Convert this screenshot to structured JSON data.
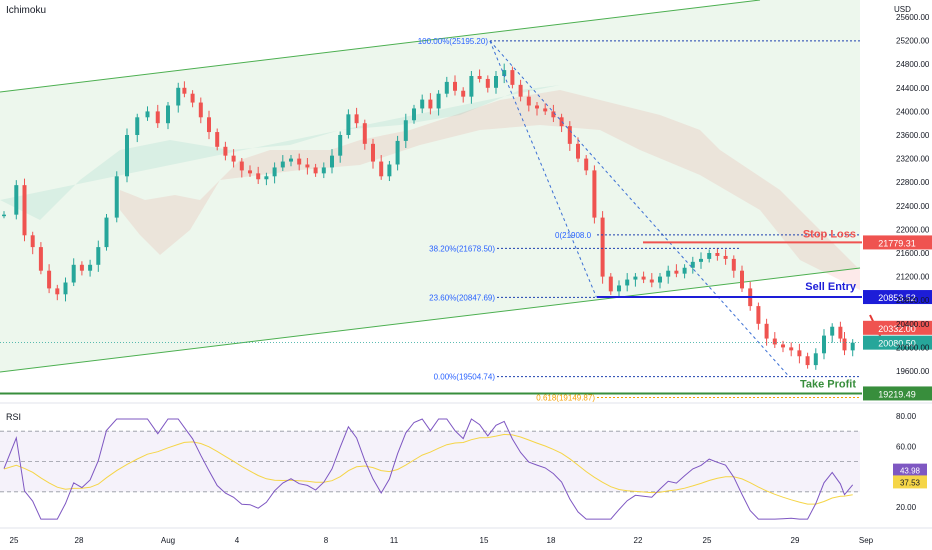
{
  "indicator_label": "Ichimoku",
  "currency": "USD",
  "rsi_label": "RSI",
  "colors": {
    "up": "#26a69a",
    "down": "#ef5350",
    "channel": "#4caf50",
    "fib_line": "#1e40af",
    "stop_loss": "#ef5350",
    "sell_entry": "#1d1dd8",
    "take_profit": "#388e3c",
    "fib_ext": "#f59f00",
    "rsi_line": "#7e57c2",
    "rsi_ma": "#f5d547"
  },
  "price_axis": {
    "min": 19000,
    "max": 25800,
    "ticks": [
      "25600.00",
      "25200.00",
      "24800.00",
      "24400.00",
      "24000.00",
      "23600.00",
      "23200.00",
      "22800.00",
      "22400.00",
      "22000.00",
      "21600.00",
      "21200.00",
      "20800.00",
      "20400.00",
      "20000.00",
      "19600.00"
    ]
  },
  "rsi_axis": {
    "ticks": [
      "80.00",
      "60.00",
      "40.00",
      "20.00"
    ],
    "upper_band": 70,
    "lower_band": 30,
    "mid": 50,
    "rsi_value": "43.98",
    "ma_value": "37.53"
  },
  "time_axis": [
    "25",
    "28",
    "Aug",
    "4",
    "8",
    "11",
    "15",
    "18",
    "22",
    "25",
    "29",
    "Sep"
  ],
  "fib_levels": [
    {
      "label": "100.00%(25195.20)",
      "value": 25195.2
    },
    {
      "label": "38.20%(21678.50)",
      "value": 21678.5
    },
    {
      "label": "23.60%(20847.69)",
      "value": 20847.69
    },
    {
      "label": "0.00%(19504.74)",
      "value": 19504.74
    }
  ],
  "fib_ext": {
    "label": "0.618(19149.87)",
    "value": 19149.87
  },
  "fib_small": {
    "label": "0(21908.0",
    "value": 21908
  },
  "levels": {
    "stop_loss": {
      "label": "Stop Loss",
      "price": "21779.31",
      "value": 21779.31
    },
    "sell_entry": {
      "label": "Sell Entry",
      "price": "20853.52",
      "value": 20853.52
    },
    "take_profit": {
      "label": "Take Profit",
      "price": "19219.49",
      "value": 19219.49
    }
  },
  "price_badges": [
    {
      "price": "20332.00",
      "value": 20332.0,
      "color": "#ef5350"
    },
    {
      "price": "20080.50",
      "value": 20080.5,
      "color": "#26a69a"
    }
  ],
  "chart_data": {
    "type": "candlestick",
    "series_points": [
      [
        0,
        22250
      ],
      [
        6,
        22750
      ],
      [
        10,
        21900
      ],
      [
        14,
        21700
      ],
      [
        18,
        21300
      ],
      [
        22,
        21000
      ],
      [
        26,
        20900
      ],
      [
        30,
        21100
      ],
      [
        34,
        21400
      ],
      [
        38,
        21300
      ],
      [
        42,
        21400
      ],
      [
        46,
        21700
      ],
      [
        50,
        22200
      ],
      [
        55,
        22900
      ],
      [
        60,
        23600
      ],
      [
        65,
        23900
      ],
      [
        70,
        24000
      ],
      [
        75,
        23800
      ],
      [
        80,
        24100
      ],
      [
        85,
        24400
      ],
      [
        88,
        24300
      ],
      [
        92,
        24150
      ],
      [
        96,
        23900
      ],
      [
        100,
        23650
      ],
      [
        104,
        23400
      ],
      [
        108,
        23250
      ],
      [
        112,
        23150
      ],
      [
        116,
        23000
      ],
      [
        120,
        22950
      ],
      [
        124,
        22850
      ],
      [
        128,
        22900
      ],
      [
        132,
        23050
      ],
      [
        136,
        23150
      ],
      [
        140,
        23200
      ],
      [
        144,
        23100
      ],
      [
        148,
        23050
      ],
      [
        152,
        22950
      ],
      [
        156,
        23050
      ],
      [
        160,
        23250
      ],
      [
        164,
        23600
      ],
      [
        168,
        23950
      ],
      [
        172,
        23800
      ],
      [
        176,
        23450
      ],
      [
        180,
        23150
      ],
      [
        184,
        22900
      ],
      [
        188,
        23100
      ],
      [
        192,
        23500
      ],
      [
        196,
        23850
      ],
      [
        200,
        24050
      ],
      [
        204,
        24200
      ],
      [
        208,
        24050
      ],
      [
        212,
        24300
      ],
      [
        216,
        24500
      ],
      [
        220,
        24350
      ],
      [
        224,
        24250
      ],
      [
        228,
        24600
      ],
      [
        232,
        24550
      ],
      [
        236,
        24400
      ],
      [
        240,
        24600
      ],
      [
        244,
        24700
      ],
      [
        248,
        24450
      ],
      [
        252,
        24250
      ],
      [
        256,
        24100
      ],
      [
        260,
        24050
      ],
      [
        264,
        24000
      ],
      [
        268,
        23900
      ],
      [
        272,
        23750
      ],
      [
        276,
        23450
      ],
      [
        280,
        23200
      ],
      [
        284,
        23000
      ],
      [
        288,
        22200
      ],
      [
        292,
        21200
      ],
      [
        296,
        20950
      ],
      [
        300,
        21050
      ],
      [
        304,
        21150
      ],
      [
        308,
        21200
      ],
      [
        312,
        21150
      ],
      [
        316,
        21100
      ],
      [
        320,
        21200
      ],
      [
        324,
        21300
      ],
      [
        328,
        21250
      ],
      [
        332,
        21350
      ],
      [
        336,
        21450
      ],
      [
        340,
        21500
      ],
      [
        344,
        21600
      ],
      [
        348,
        21550
      ],
      [
        352,
        21500
      ],
      [
        356,
        21300
      ],
      [
        360,
        21000
      ],
      [
        364,
        20700
      ],
      [
        368,
        20400
      ],
      [
        372,
        20150
      ],
      [
        376,
        20050
      ],
      [
        380,
        20000
      ],
      [
        384,
        19950
      ],
      [
        388,
        19850
      ],
      [
        392,
        19700
      ],
      [
        396,
        19900
      ],
      [
        400,
        20200
      ],
      [
        404,
        20350
      ],
      [
        408,
        20150
      ],
      [
        410,
        19950
      ],
      [
        414,
        20080
      ]
    ]
  }
}
